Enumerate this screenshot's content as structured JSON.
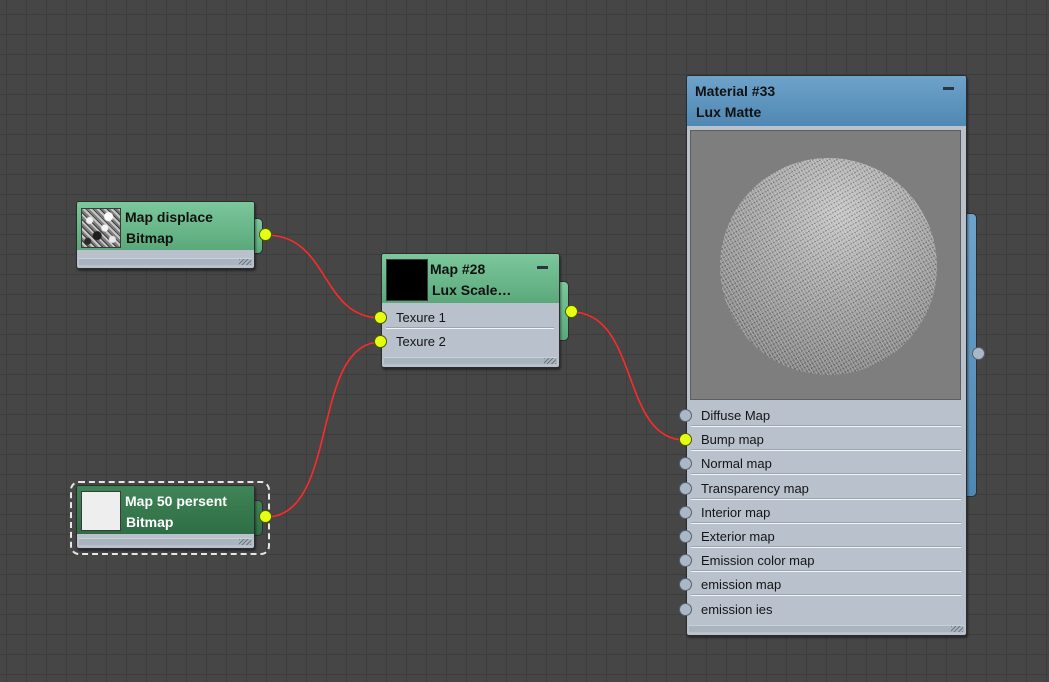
{
  "nodes": {
    "map_displace": {
      "title": "Map displace",
      "type": "Bitmap"
    },
    "map_50": {
      "title": "Map 50 persent",
      "type": "Bitmap"
    },
    "map_28": {
      "title": "Map #28",
      "type": "Lux  Scale…",
      "inputs": [
        "Texure 1",
        "Texure 2"
      ]
    },
    "material_33": {
      "title": "Material #33",
      "type": "Lux Matte",
      "inputs": [
        "Diffuse Map",
        "Bump map",
        "Normal map",
        "Transparency map",
        "Interior map",
        "Exterior map",
        "Emission color map",
        "emission map",
        "emission ies"
      ]
    }
  },
  "colors": {
    "wire": "#ff2a2a",
    "socket_connected": "#e4ff12",
    "socket_empty": "#a9b7c6",
    "bitmap_header": "#5fae80",
    "selected_bitmap_header": "#357a4c",
    "material_header": "#5a92bd"
  },
  "icons": {
    "collapse": "minus-icon",
    "resize": "resize-grip-icon"
  }
}
